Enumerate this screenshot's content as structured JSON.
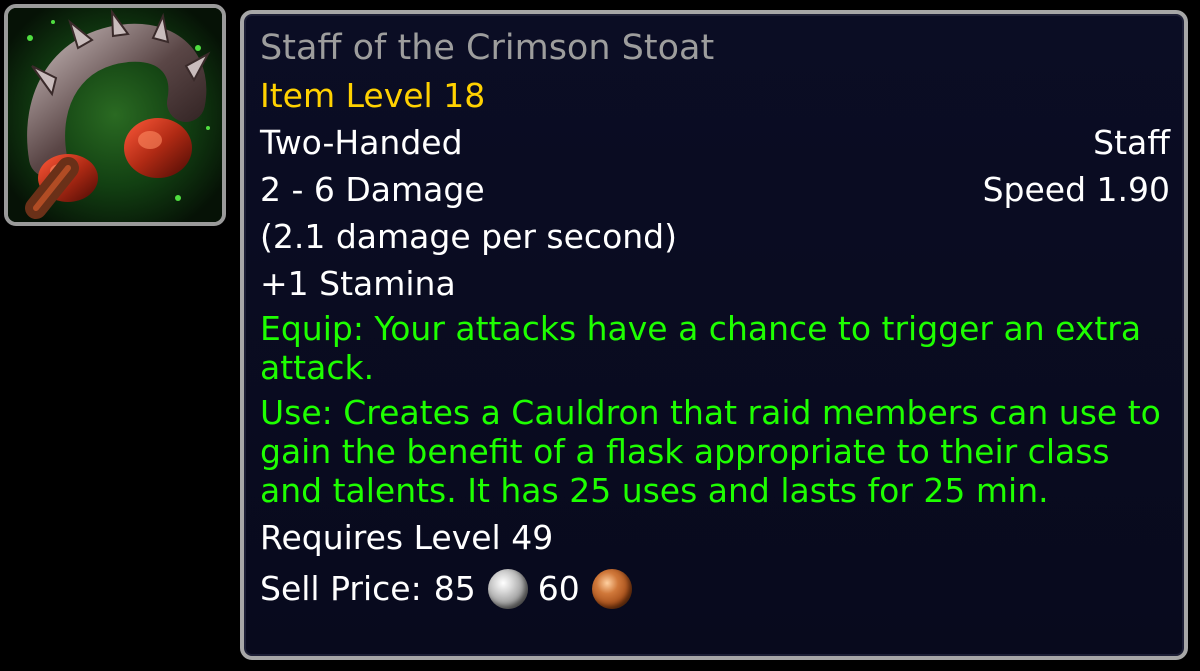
{
  "icon": {
    "name": "staff-icon"
  },
  "item": {
    "name": "Staff of the Crimson Stoat",
    "item_level": "Item Level 18",
    "handedness": "Two-Handed",
    "weapon_type": "Staff",
    "damage": "2 - 6 Damage",
    "speed": "Speed 1.90",
    "dps": "(2.1 damage per second)",
    "stat": "+1 Stamina",
    "equip_effect": "Equip: Your attacks have a chance to trigger an extra attack.",
    "use_effect": "Use: Creates a Cauldron that raid members can use to gain the benefit of a flask appropriate to their class and talents. It has 25 uses and lasts for 25 min.",
    "requirement": "Requires Level 49",
    "sell_price_label": "Sell Price:",
    "sell_silver": "85",
    "sell_copper": "60"
  },
  "colors": {
    "name_poor_quality": "#9d9d9d",
    "item_level": "#ffd100",
    "effect_green": "#1eff00",
    "text_white": "#ffffff",
    "background": "#0b0d24",
    "border": "#a7a7a7"
  },
  "coin_icons": [
    "silver-coin-icon",
    "copper-coin-icon"
  ]
}
